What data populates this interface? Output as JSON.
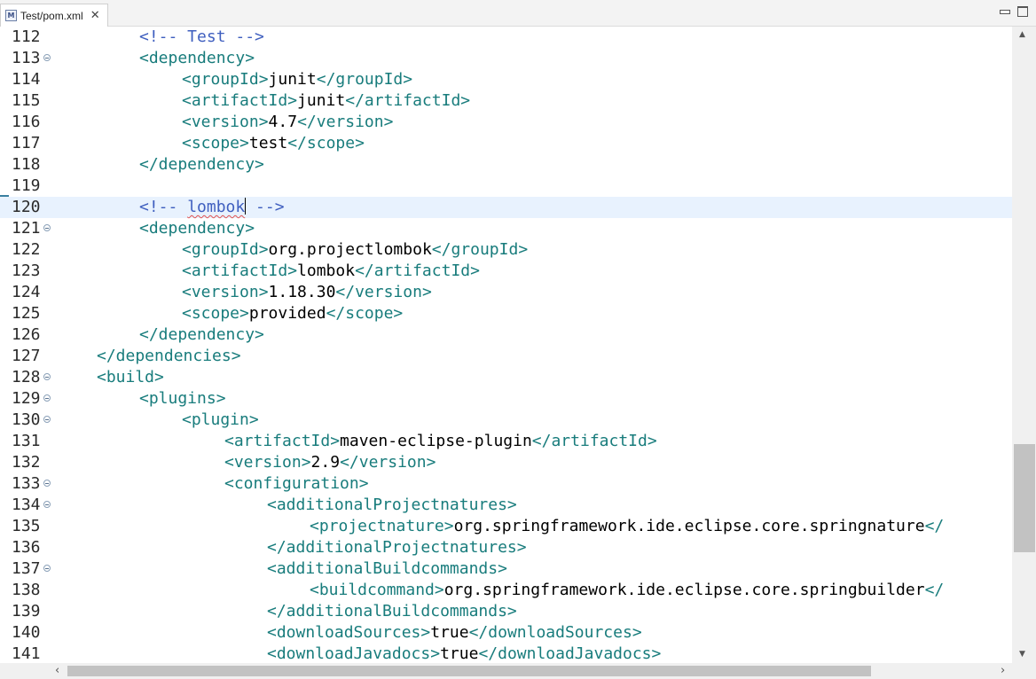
{
  "tab": {
    "title": "Test/pom.xml",
    "icon": "maven-file-icon",
    "icon_letter": "M"
  },
  "lines": [
    {
      "n": "112",
      "fold": false,
      "current": false,
      "indent": 2,
      "parts": [
        {
          "t": "c",
          "s": "<!-- Test -->"
        }
      ]
    },
    {
      "n": "113",
      "fold": true,
      "current": false,
      "indent": 2,
      "parts": [
        {
          "t": "t",
          "s": "<dependency>"
        }
      ]
    },
    {
      "n": "114",
      "fold": false,
      "current": false,
      "indent": 3,
      "parts": [
        {
          "t": "t",
          "s": "<groupId>"
        },
        {
          "t": "v",
          "s": "junit"
        },
        {
          "t": "t",
          "s": "</groupId>"
        }
      ]
    },
    {
      "n": "115",
      "fold": false,
      "current": false,
      "indent": 3,
      "parts": [
        {
          "t": "t",
          "s": "<artifactId>"
        },
        {
          "t": "v",
          "s": "junit"
        },
        {
          "t": "t",
          "s": "</artifactId>"
        }
      ]
    },
    {
      "n": "116",
      "fold": false,
      "current": false,
      "indent": 3,
      "parts": [
        {
          "t": "t",
          "s": "<version>"
        },
        {
          "t": "v",
          "s": "4.7"
        },
        {
          "t": "t",
          "s": "</version>"
        }
      ]
    },
    {
      "n": "117",
      "fold": false,
      "current": false,
      "indent": 3,
      "parts": [
        {
          "t": "t",
          "s": "<scope>"
        },
        {
          "t": "v",
          "s": "test"
        },
        {
          "t": "t",
          "s": "</scope>"
        }
      ]
    },
    {
      "n": "118",
      "fold": false,
      "current": false,
      "indent": 2,
      "parts": [
        {
          "t": "t",
          "s": "</dependency>"
        }
      ]
    },
    {
      "n": "119",
      "fold": false,
      "current": false,
      "indent": 0,
      "parts": []
    },
    {
      "n": "120",
      "fold": false,
      "current": true,
      "indent": 2,
      "parts": [
        {
          "t": "c",
          "s": "<!-- "
        },
        {
          "t": "cw",
          "s": "lombok"
        },
        {
          "t": "caret",
          "s": ""
        },
        {
          "t": "c",
          "s": " -->"
        }
      ]
    },
    {
      "n": "121",
      "fold": true,
      "current": false,
      "indent": 2,
      "parts": [
        {
          "t": "t",
          "s": "<dependency>"
        }
      ]
    },
    {
      "n": "122",
      "fold": false,
      "current": false,
      "indent": 3,
      "parts": [
        {
          "t": "t",
          "s": "<groupId>"
        },
        {
          "t": "v",
          "s": "org.projectlombok"
        },
        {
          "t": "t",
          "s": "</groupId>"
        }
      ]
    },
    {
      "n": "123",
      "fold": false,
      "current": false,
      "indent": 3,
      "parts": [
        {
          "t": "t",
          "s": "<artifactId>"
        },
        {
          "t": "v",
          "s": "lombok"
        },
        {
          "t": "t",
          "s": "</artifactId>"
        }
      ]
    },
    {
      "n": "124",
      "fold": false,
      "current": false,
      "indent": 3,
      "parts": [
        {
          "t": "t",
          "s": "<version>"
        },
        {
          "t": "v",
          "s": "1.18.30"
        },
        {
          "t": "t",
          "s": "</version>"
        }
      ]
    },
    {
      "n": "125",
      "fold": false,
      "current": false,
      "indent": 3,
      "parts": [
        {
          "t": "t",
          "s": "<scope>"
        },
        {
          "t": "v",
          "s": "provided"
        },
        {
          "t": "t",
          "s": "</scope>"
        }
      ]
    },
    {
      "n": "126",
      "fold": false,
      "current": false,
      "indent": 2,
      "parts": [
        {
          "t": "t",
          "s": "</dependency>"
        }
      ]
    },
    {
      "n": "127",
      "fold": false,
      "current": false,
      "indent": 1,
      "parts": [
        {
          "t": "t",
          "s": "</dependencies>"
        }
      ]
    },
    {
      "n": "128",
      "fold": true,
      "current": false,
      "indent": 1,
      "parts": [
        {
          "t": "t",
          "s": "<build>"
        }
      ]
    },
    {
      "n": "129",
      "fold": true,
      "current": false,
      "indent": 2,
      "parts": [
        {
          "t": "t",
          "s": "<plugins>"
        }
      ]
    },
    {
      "n": "130",
      "fold": true,
      "current": false,
      "indent": 3,
      "parts": [
        {
          "t": "t",
          "s": "<plugin>"
        }
      ]
    },
    {
      "n": "131",
      "fold": false,
      "current": false,
      "indent": 4,
      "parts": [
        {
          "t": "t",
          "s": "<artifactId>"
        },
        {
          "t": "v",
          "s": "maven-eclipse-plugin"
        },
        {
          "t": "t",
          "s": "</artifactId>"
        }
      ]
    },
    {
      "n": "132",
      "fold": false,
      "current": false,
      "indent": 4,
      "parts": [
        {
          "t": "t",
          "s": "<version>"
        },
        {
          "t": "v",
          "s": "2.9"
        },
        {
          "t": "t",
          "s": "</version>"
        }
      ]
    },
    {
      "n": "133",
      "fold": true,
      "current": false,
      "indent": 4,
      "parts": [
        {
          "t": "t",
          "s": "<configuration>"
        }
      ]
    },
    {
      "n": "134",
      "fold": true,
      "current": false,
      "indent": 5,
      "parts": [
        {
          "t": "t",
          "s": "<additionalProjectnatures>"
        }
      ]
    },
    {
      "n": "135",
      "fold": false,
      "current": false,
      "indent": 6,
      "parts": [
        {
          "t": "t",
          "s": "<projectnature>"
        },
        {
          "t": "v",
          "s": "org.springframework.ide.eclipse.core.springnature"
        },
        {
          "t": "t",
          "s": "</"
        }
      ]
    },
    {
      "n": "136",
      "fold": false,
      "current": false,
      "indent": 5,
      "parts": [
        {
          "t": "t",
          "s": "</additionalProjectnatures>"
        }
      ]
    },
    {
      "n": "137",
      "fold": true,
      "current": false,
      "indent": 5,
      "parts": [
        {
          "t": "t",
          "s": "<additionalBuildcommands>"
        }
      ]
    },
    {
      "n": "138",
      "fold": false,
      "current": false,
      "indent": 6,
      "parts": [
        {
          "t": "t",
          "s": "<buildcommand>"
        },
        {
          "t": "v",
          "s": "org.springframework.ide.eclipse.core.springbuilder"
        },
        {
          "t": "t",
          "s": "</"
        }
      ]
    },
    {
      "n": "139",
      "fold": false,
      "current": false,
      "indent": 5,
      "parts": [
        {
          "t": "t",
          "s": "</additionalBuildcommands>"
        }
      ]
    },
    {
      "n": "140",
      "fold": false,
      "current": false,
      "indent": 5,
      "parts": [
        {
          "t": "t",
          "s": "<downloadSources>"
        },
        {
          "t": "v",
          "s": "true"
        },
        {
          "t": "t",
          "s": "</downloadSources>"
        }
      ]
    },
    {
      "n": "141",
      "fold": false,
      "current": false,
      "indent": 5,
      "parts": [
        {
          "t": "t",
          "s": "<downloadJavadocs>"
        },
        {
          "t": "v",
          "s": "true"
        },
        {
          "t": "t",
          "s": "</downloadJavadocs>"
        }
      ]
    }
  ],
  "colors": {
    "tag": "#187c7c",
    "comment": "#3f5fbf",
    "text": "#000000",
    "current_line": "#e8f2fe"
  }
}
